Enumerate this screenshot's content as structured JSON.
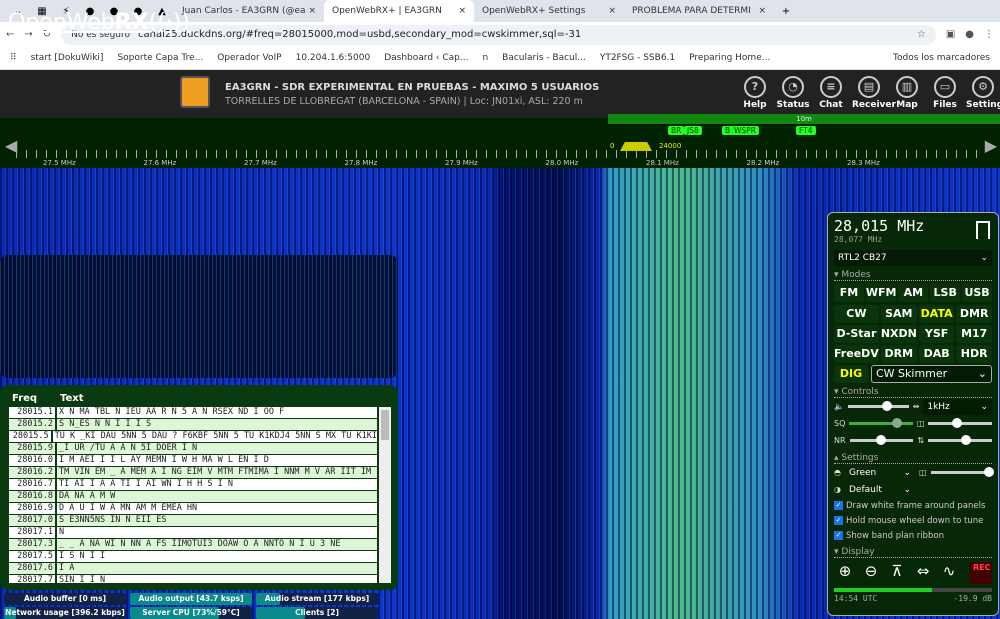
{
  "browser": {
    "tabs": [
      "Juan Carlos - EA3GRN (@ea",
      "OpenWebRX+ | EA3GRN",
      "OpenWebRX+ Settings",
      "PROBLEMA PARA DETERMI"
    ],
    "security": "No es seguro",
    "url": "canal25.duckdns.org/#freq=28015000,mod=usbd,secondary_mod=cwskimmer,sql=-31",
    "bookmarks": [
      "start [DokuWiki]",
      "Soporte Capa Tre...",
      "Operador VoIP",
      "10.204.1.6:5000",
      "Dashboard ‹ Cap...",
      "n",
      "Bacularis - Bacul...",
      "YT2FSG - SSB6.1",
      "Preparing Home...",
      "Todos los marcadores"
    ]
  },
  "header": {
    "logo_a": "OpenWeb",
    "logo_b": "RX",
    "title": "EA3GRN - SDR EXPERIMENTAL EN PRUEBAS - MAXIMO 5 USUARIOS",
    "subtitle": "TORRELLES DE LLOBREGAT (BARCELONA - SPAIN) | Loc: JN01xi, ASL: 220 m",
    "nav": [
      {
        "label": "Help",
        "icon": "?"
      },
      {
        "label": "Status",
        "icon": "◔"
      },
      {
        "label": "Chat",
        "icon": "≡"
      },
      {
        "label": "Receiver",
        "icon": "▤"
      },
      {
        "label": "Map",
        "icon": "▥"
      },
      {
        "label": "Files",
        "icon": "▭"
      },
      {
        "label": "Settings",
        "icon": "⚙"
      }
    ]
  },
  "scale": {
    "band": "10m",
    "labels": [
      "27.5 MHz",
      "27.6 MHz",
      "27.7 MHz",
      "27.8 MHz",
      "27.9 MHz",
      "28.0 MHz",
      "28.1 MHz",
      "28.2 MHz",
      "28.3 MHz"
    ],
    "markers": [
      "BR",
      "JS8",
      "B",
      "WSPR",
      "FT4"
    ],
    "filter_low": "0",
    "filter_high": "24000"
  },
  "skimmer": {
    "headers": [
      "Freq",
      "Text"
    ],
    "rows": [
      [
        "28015.1",
        "X N MA TBL N IEU AA R N 5 A N RSEX ND I OO F"
      ],
      [
        "28015.2",
        "S N_ES N N I I I S"
      ],
      [
        "28015.5",
        "TU K _KI DAU 5NN 5 DAU ? F6KBF 5NN 5 TU K1KDJ4 5NN S MX TU K1KI"
      ],
      [
        "28015.9",
        "_I UR /TU A A N 5I DOER I N"
      ],
      [
        "28016.0",
        "I M AEI I I L AY MEMN I W H MA W L EN I D"
      ],
      [
        "28016.2",
        "TM VIN EM _ A MEM A I NG EIM V MTM FTMIMA I NNM M V AR IIT IM"
      ],
      [
        "28016.7",
        "TI AI I A A TI I AI WN I H H S I N"
      ],
      [
        "28016.8",
        "DA NA A M W"
      ],
      [
        "28016.9",
        "D A U I W A MN AM M EMEA HN"
      ],
      [
        "28017.0",
        "S E3NN5NS IN N EII ES"
      ],
      [
        "28017.1",
        "N"
      ],
      [
        "28017.3",
        "_ _ A NA WI N NN A FS IIMOTUI3 DOAW O A NNTO N I U 3 NE"
      ],
      [
        "28017.5",
        "I S N I I"
      ],
      [
        "28017.6",
        "I A"
      ],
      [
        "28017.7",
        "SIN I I N"
      ]
    ]
  },
  "status": [
    {
      "label": "Audio buffer [0 ms]",
      "fill": 0
    },
    {
      "label": "Audio output [43.7 ksps]",
      "fill": 1
    },
    {
      "label": "Audio stream [177 kbps]",
      "fill": 0.2
    },
    {
      "label": "Network usage [396.2 kbps]",
      "fill": 0.1
    },
    {
      "label": "Server CPU [73%/59°C]",
      "fill": 0.73
    },
    {
      "label": "Clients [2]",
      "fill": 0.4
    }
  ],
  "panel": {
    "freq": "28,015 MHz",
    "freq2": "28,077 MHz",
    "profile": "RTL2 CB27",
    "modes_label": "Modes",
    "modes": [
      "FM",
      "WFM",
      "AM",
      "LSB",
      "USB",
      "CW",
      "SAM",
      "DATA",
      "DMR",
      "D-Star",
      "NXDN",
      "YSF",
      "M17",
      "FreeDV",
      "DRM",
      "DAB",
      "HDR"
    ],
    "dig": "DIG",
    "secondary": "CW Skimmer",
    "controls_label": "Controls",
    "bandwidth": "1kHz",
    "sq": "SQ",
    "nr": "NR",
    "settings_label": "Settings",
    "theme": "Green",
    "palette": "Default",
    "checks": [
      "Draw white frame around panels",
      "Hold mouse wheel down to tune",
      "Show band plan ribbon"
    ],
    "display_label": "Display",
    "rec": "REC",
    "utc": "14:54 UTC",
    "db": "-19.9 dB",
    "level": 0.62,
    "volume": 0.65,
    "squelch": 0.75,
    "nr_level": 0.5,
    "zoom_level": 0.45,
    "agc_level": 0.6,
    "opacity": 0.95
  },
  "colors": {
    "accent": "#ffff00",
    "panel": "#072807"
  }
}
